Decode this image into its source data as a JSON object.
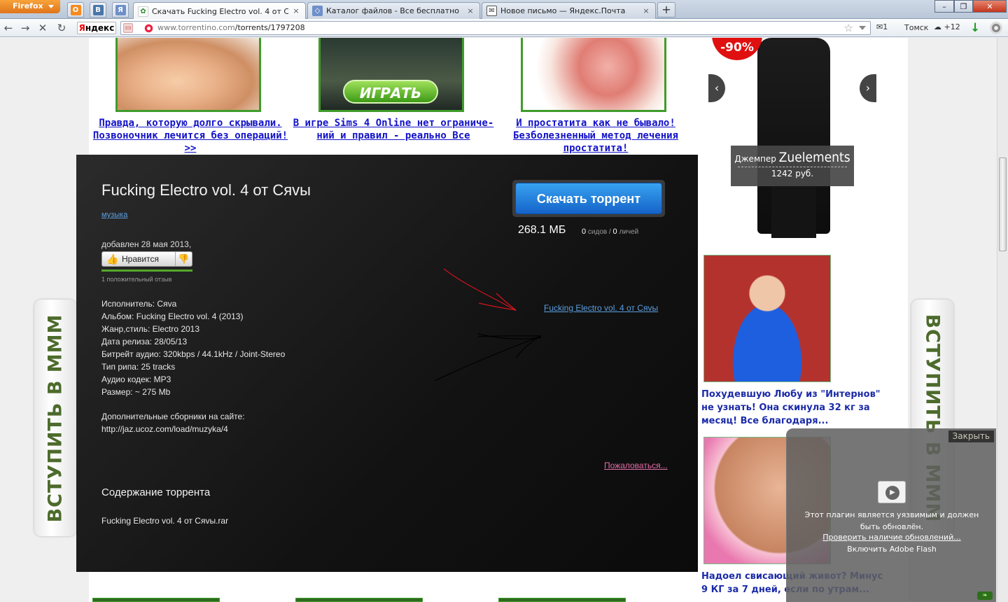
{
  "browser": {
    "menu_button": "Firefox",
    "tabs": [
      {
        "title": "Скачать Fucking Electro vol. 4 от Сяv...",
        "close": "×"
      },
      {
        "title": "Каталог файлов - Все бесплатно",
        "close": "×"
      },
      {
        "title": "Новое письмо — Яндекс.Почта",
        "close": "×"
      }
    ],
    "new_tab": "+",
    "app_tabs": [
      "О",
      "В",
      "Я"
    ],
    "window": {
      "minimize": "–",
      "maximize": "❐",
      "close": "✕"
    },
    "nav": {
      "back": "←",
      "forward": "→",
      "stop": "✕",
      "reload": "↻"
    },
    "yandex_logo_first": "Я",
    "yandex_logo_rest": "ндекс",
    "url_host": "www.torrentino.com",
    "url_path": "/torrents/1797208",
    "mail_count": "✉1",
    "city": "Томск",
    "weather": "☁ +12",
    "download": "↓"
  },
  "promos": [
    {
      "link": "Правда, которую долго скрывали. Позвоночник лечится без операций! >>"
    },
    {
      "link": "В игре Sims 4 Online нет ограниче-ний и правил - реально Все",
      "play_label": "ИГРАТЬ"
    },
    {
      "link": "И простатита как не бывало! Безболезненный метод лечения простатита!"
    }
  ],
  "right_ads": {
    "jacket": {
      "sale": "-90%",
      "name": "Джемпер",
      "brand": "Zuelements",
      "price": "1242 руб.",
      "prev": "‹",
      "next": "›"
    },
    "ad1": "Похудевшую Любу из \"Интернов\" не узнать! Она скинула 32 кг за месяц! Все благодаря...",
    "ad2": "Надоел свисающий живот? Минус 9 КГ за 7 дней, если по утрам..."
  },
  "side_banner_text": "ВСТУПИТЬ В МММ",
  "torrent": {
    "title": "Fucking Electro vol. 4 от Сяvы",
    "category": "музыка",
    "download_button": "Скачать торрент",
    "size": "268.1 МБ",
    "seeds_count": "0",
    "seeds_label": " сидов / ",
    "leechers_count": "0",
    "leechers_label": " личей",
    "added": "добавлен 28 мая 2013,",
    "like_button": "Нравится",
    "like_icon": "👍",
    "dislike_icon": "👎",
    "reviews": "1 положительный отзыв",
    "info_lines": [
      "Исполнитель: Сяva",
      "Альбом: Fucking Electro vol. 4 (2013)",
      "Жанр,стиль: Electro 2013",
      "Дата релиза: 28/05/13",
      "Битрейт аудио: 320kbps / 44.1kHz / Joint-Stereo",
      "Тип рипа: 25 tracks",
      "Аудио кодек: MP3",
      "Размер: ~ 275 Mb"
    ],
    "extra_lines": [
      "Дополнительные сборники на сайте:",
      "http://jaz.ucoz.com/load/muzyka/4"
    ],
    "side_link": "Fucking Electro vol. 4 от Сяvы",
    "complain": "Пожаловаться...",
    "contents_heading": "Содержание торрента",
    "file": "Fucking Electro vol. 4 от Сяvы.rar"
  },
  "flash": {
    "close": "Закрыть",
    "message": "Этот плагин является уязвимым и должен быть обновлён.",
    "check_updates": "Проверить наличие обновлений...",
    "enable": "Включить Adobe Flash",
    "play_icon": "▶"
  },
  "colors": {
    "link_blue": "#1313c9",
    "promo_border": "#3f9c2a",
    "card_bg": "#121212",
    "download_blue": "#1f7ad8",
    "banner_green": "#4d6b2c",
    "complain_pink": "#e46dab"
  }
}
